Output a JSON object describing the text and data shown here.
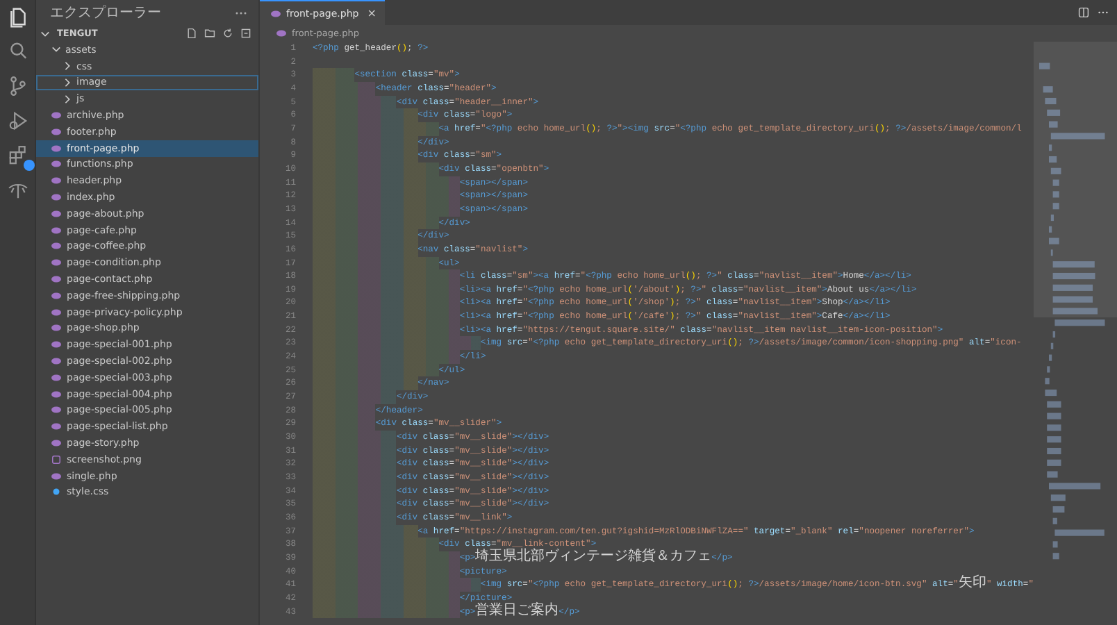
{
  "explorer": {
    "title": "エクスプローラー",
    "folder": "TENGUT",
    "tree": [
      {
        "name": "assets",
        "kind": "folder",
        "expanded": true,
        "selected": false,
        "focused": false,
        "children": [
          {
            "name": "css",
            "kind": "folder",
            "expanded": false,
            "selected": false,
            "focused": false
          },
          {
            "name": "image",
            "kind": "folder",
            "expanded": false,
            "selected": false,
            "focused": true
          },
          {
            "name": "js",
            "kind": "folder",
            "expanded": false,
            "selected": false,
            "focused": false
          }
        ]
      },
      {
        "name": "archive.php",
        "kind": "php",
        "selected": false,
        "focused": false
      },
      {
        "name": "footer.php",
        "kind": "php",
        "selected": false,
        "focused": false
      },
      {
        "name": "front-page.php",
        "kind": "php",
        "selected": true,
        "focused": false
      },
      {
        "name": "functions.php",
        "kind": "php",
        "selected": false,
        "focused": false
      },
      {
        "name": "header.php",
        "kind": "php",
        "selected": false,
        "focused": false
      },
      {
        "name": "index.php",
        "kind": "php",
        "selected": false,
        "focused": false
      },
      {
        "name": "page-about.php",
        "kind": "php",
        "selected": false,
        "focused": false
      },
      {
        "name": "page-cafe.php",
        "kind": "php",
        "selected": false,
        "focused": false
      },
      {
        "name": "page-coffee.php",
        "kind": "php",
        "selected": false,
        "focused": false
      },
      {
        "name": "page-condition.php",
        "kind": "php",
        "selected": false,
        "focused": false
      },
      {
        "name": "page-contact.php",
        "kind": "php",
        "selected": false,
        "focused": false
      },
      {
        "name": "page-free-shipping.php",
        "kind": "php",
        "selected": false,
        "focused": false
      },
      {
        "name": "page-privacy-policy.php",
        "kind": "php",
        "selected": false,
        "focused": false
      },
      {
        "name": "page-shop.php",
        "kind": "php",
        "selected": false,
        "focused": false
      },
      {
        "name": "page-special-001.php",
        "kind": "php",
        "selected": false,
        "focused": false
      },
      {
        "name": "page-special-002.php",
        "kind": "php",
        "selected": false,
        "focused": false
      },
      {
        "name": "page-special-003.php",
        "kind": "php",
        "selected": false,
        "focused": false
      },
      {
        "name": "page-special-004.php",
        "kind": "php",
        "selected": false,
        "focused": false
      },
      {
        "name": "page-special-005.php",
        "kind": "php",
        "selected": false,
        "focused": false
      },
      {
        "name": "page-special-list.php",
        "kind": "php",
        "selected": false,
        "focused": false
      },
      {
        "name": "page-story.php",
        "kind": "php",
        "selected": false,
        "focused": false
      },
      {
        "name": "screenshot.png",
        "kind": "image",
        "selected": false,
        "focused": false
      },
      {
        "name": "single.php",
        "kind": "php",
        "selected": false,
        "focused": false
      },
      {
        "name": "style.css",
        "kind": "css",
        "selected": false,
        "focused": false
      }
    ]
  },
  "tabs": [
    {
      "label": "front-page.php",
      "selected": true,
      "close": "×"
    }
  ],
  "breadcrumb": "front-page.php",
  "code": [
    {
      "number": "1",
      "text": "<?php get_header(); ?>"
    },
    {
      "number": "2"
    },
    {
      "number": "3",
      "text": "        <section class=\"mv\">"
    },
    {
      "number": "4",
      "text": "            <header class=\"header\">"
    },
    {
      "number": "5",
      "text": "                <div class=\"header__inner\">"
    },
    {
      "number": "6",
      "text": "                    <div class=\"logo\">"
    },
    {
      "number": "7",
      "text": "                        <a href=\"<?php echo home_url(); ?>\"><img src=\"<?php echo get_template_directory_uri(); ?>/assets/image/common/l"
    },
    {
      "number": "8",
      "text": "                    </div>"
    },
    {
      "number": "9",
      "text": "                    <div class=\"sm\">"
    },
    {
      "number": "10",
      "text": "                        <div class=\"openbtn\">"
    },
    {
      "number": "11",
      "text": "                            <span></span>"
    },
    {
      "number": "12",
      "text": "                            <span></span>"
    },
    {
      "number": "13",
      "text": "                            <span></span>"
    },
    {
      "number": "14",
      "text": "                        </div>"
    },
    {
      "number": "15",
      "text": "                    </div>"
    },
    {
      "number": "16",
      "text": "                    <nav class=\"navlist\">"
    },
    {
      "number": "17",
      "text": "                        <ul>"
    },
    {
      "number": "18",
      "text": "                            <li class=\"sm\"><a href=\"<?php echo home_url(); ?>\" class=\"navlist__item\">Home</a></li>"
    },
    {
      "number": "19",
      "text": "                            <li><a href=\"<?php echo home_url('/about'); ?>\" class=\"navlist__item\">About us</a></li>"
    },
    {
      "number": "20",
      "text": "                            <li><a href=\"<?php echo home_url('/shop'); ?>\" class=\"navlist__item\">Shop</a></li>"
    },
    {
      "number": "21",
      "text": "                            <li><a href=\"<?php echo home_url('/cafe'); ?>\" class=\"navlist__item\">Cafe</a></li>"
    },
    {
      "number": "22",
      "text": "                            <li><a href=\"https://tengut.square.site/\" class=\"navlist__item navlist__item-icon-position\">"
    },
    {
      "number": "23",
      "text": "                                <img src=\"<?php echo get_template_directory_uri(); ?>/assets/image/common/icon-shopping.png\" alt=\"icon-"
    },
    {
      "number": "24",
      "text": "                            </li>"
    },
    {
      "number": "25",
      "text": "                        </ul>"
    },
    {
      "number": "26",
      "text": "                    </nav>"
    },
    {
      "number": "27",
      "text": "                </div>"
    },
    {
      "number": "28",
      "text": "            </header>"
    },
    {
      "number": "29",
      "text": "            <div class=\"mv__slider\">"
    },
    {
      "number": "30",
      "text": "                <div class=\"mv__slide\"></div>"
    },
    {
      "number": "31",
      "text": "                <div class=\"mv__slide\"></div>"
    },
    {
      "number": "32",
      "text": "                <div class=\"mv__slide\"></div>"
    },
    {
      "number": "33",
      "text": "                <div class=\"mv__slide\"></div>"
    },
    {
      "number": "34",
      "text": "                <div class=\"mv__slide\"></div>"
    },
    {
      "number": "35",
      "text": "                <div class=\"mv__slide\"></div>"
    },
    {
      "number": "36",
      "text": "                <div class=\"mv__link\">"
    },
    {
      "number": "37",
      "text": "                    <a href=\"https://instagram.com/ten.gut?igshid=MzRlODBiNWFlZA==\" target=\"_blank\" rel=\"noopener noreferrer\">"
    },
    {
      "number": "38",
      "text": "                        <div class=\"mv__link-content\">"
    },
    {
      "number": "39",
      "text": "                            <p>埼玉県北部ヴィンテージ雑貨＆カフェ</p>"
    },
    {
      "number": "40",
      "text": "                            <picture>"
    },
    {
      "number": "41",
      "text": "                                <img src=\"<?php echo get_template_directory_uri(); ?>/assets/image/home/icon-btn.svg\" alt=\"矢印\" width=\""
    },
    {
      "number": "42",
      "text": "                            </picture>"
    },
    {
      "number": "43",
      "text": "                            <p>営業日ご案内</p>"
    }
  ]
}
